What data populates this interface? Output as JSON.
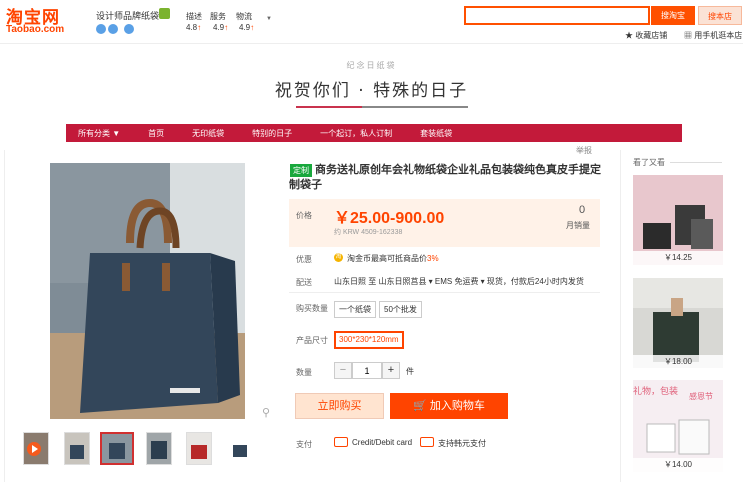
{
  "header": {
    "logo_cn": "淘宝网",
    "logo_en": "Taobao.com",
    "shop_name": "设计师品牌纸袋",
    "ratings": [
      {
        "label": "描述",
        "value": "4.8"
      },
      {
        "label": "服务",
        "value": "4.9"
      },
      {
        "label": "物流",
        "value": "4.9"
      }
    ],
    "search_placeholder": "",
    "search_taobao_label": "搜淘宝",
    "search_shop_label": "搜本店",
    "favorite_label": "收藏店铺",
    "mobile_label": "用手机逛本店"
  },
  "banner": {
    "subtitle": "纪念日纸袋",
    "title": "祝贺你们 · 特殊的日子"
  },
  "nav": {
    "items": [
      "所有分类",
      "首页",
      "无印纸袋",
      "特别的日子",
      "一个起订，私人订制",
      "套装纸袋"
    ]
  },
  "product": {
    "report_label": "举报",
    "tmall_tag": "定制",
    "title": "商务送礼原创年会礼物纸袋企业礼品包装袋纯色真皮手提定制袋子",
    "price_label": "价格",
    "price": "￥25.00-900.00",
    "price_krw": "约 KRW 4509-162338",
    "sales_count": "0",
    "sales_label": "月销量",
    "promo_label": "优惠",
    "promo_icon": "淘",
    "promo_text": "淘金币最高可抵商品价",
    "promo_pct": "3%",
    "shipping_label": "配送",
    "shipping_text": "山东日照 至  山东日照莒县  ▾  EMS 免运费  ▾  现货，付款后24小时内发货",
    "qty_purchase_label": "购买数量",
    "purchase_options": [
      "一个纸袋",
      "50个批发"
    ],
    "size_label": "产品尺寸",
    "size_value": "300*230*120mm",
    "qty_label": "数量",
    "qty_value": "1",
    "qty_unit": "件",
    "buy_now_label": "立即购买",
    "add_to_cart_label": "加入购物车",
    "payment_label": "支付",
    "payment_methods": [
      "Credit/Debit card",
      "支持韩元支付"
    ]
  },
  "sidebar": {
    "seen_label": "看了又看",
    "items": [
      {
        "price": "￥14.25"
      },
      {
        "price": "￥18.00"
      },
      {
        "price": "￥14.00"
      }
    ],
    "ad_text1": "礼物，包装",
    "ad_text2": "感恩节"
  },
  "colors": {
    "brand": "#ff4400",
    "nav": "#c31a3a",
    "tmall_green": "#19a83d"
  }
}
